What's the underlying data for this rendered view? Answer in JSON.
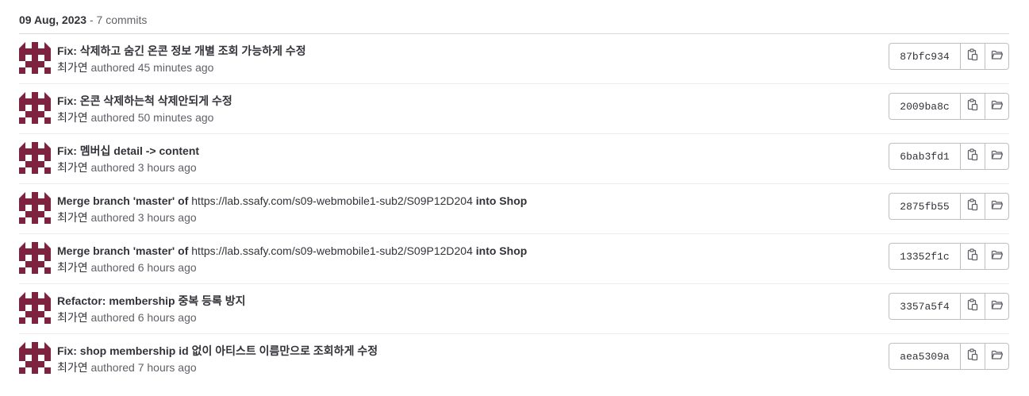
{
  "day_header": {
    "date": "09 Aug, 2023",
    "separator": " - ",
    "count": "7 commits"
  },
  "colors": {
    "avatar": "#7d2340",
    "text": "#333238",
    "muted": "#626168",
    "border": "#bfbfc3"
  },
  "icons": {
    "avatar": "identicon-avatar",
    "copy": "copy-to-clipboard-icon",
    "browse": "folder-open-icon"
  },
  "commits": [
    {
      "title_parts": [
        {
          "text": "Fix: 삭제하고 숨긴 온콘 정보 개별 조회 가능하게 수정",
          "bold": true
        }
      ],
      "author": "최가연",
      "authored": " authored ",
      "time": "45 minutes ago",
      "sha": "87bfc934"
    },
    {
      "title_parts": [
        {
          "text": "Fix: 온콘 삭제하는척 삭제안되게 수정",
          "bold": true
        }
      ],
      "author": "최가연",
      "authored": " authored ",
      "time": "50 minutes ago",
      "sha": "2009ba8c"
    },
    {
      "title_parts": [
        {
          "text": "Fix: 멤버십 detail -> content",
          "bold": true
        }
      ],
      "author": "최가연",
      "authored": " authored ",
      "time": "3 hours ago",
      "sha": "6bab3fd1"
    },
    {
      "title_parts": [
        {
          "text": "Merge branch 'master' of ",
          "bold": true
        },
        {
          "text": "https://lab.ssafy.com/s09-webmobile1-sub2/S09P12D204",
          "bold": false
        },
        {
          "text": " into Shop",
          "bold": true
        }
      ],
      "author": "최가연",
      "authored": " authored ",
      "time": "3 hours ago",
      "sha": "2875fb55"
    },
    {
      "title_parts": [
        {
          "text": "Merge branch 'master' of ",
          "bold": true
        },
        {
          "text": "https://lab.ssafy.com/s09-webmobile1-sub2/S09P12D204",
          "bold": false
        },
        {
          "text": " into Shop",
          "bold": true
        }
      ],
      "author": "최가연",
      "authored": " authored ",
      "time": "6 hours ago",
      "sha": "13352f1c"
    },
    {
      "title_parts": [
        {
          "text": "Refactor: membership 중복 등록 방지",
          "bold": true
        }
      ],
      "author": "최가연",
      "authored": " authored ",
      "time": "6 hours ago",
      "sha": "3357a5f4"
    },
    {
      "title_parts": [
        {
          "text": "Fix: shop membership id 없이 아티스트 이름만으로 조회하게 수정",
          "bold": true
        }
      ],
      "author": "최가연",
      "authored": " authored ",
      "time": "7 hours ago",
      "sha": "aea5309a"
    }
  ]
}
